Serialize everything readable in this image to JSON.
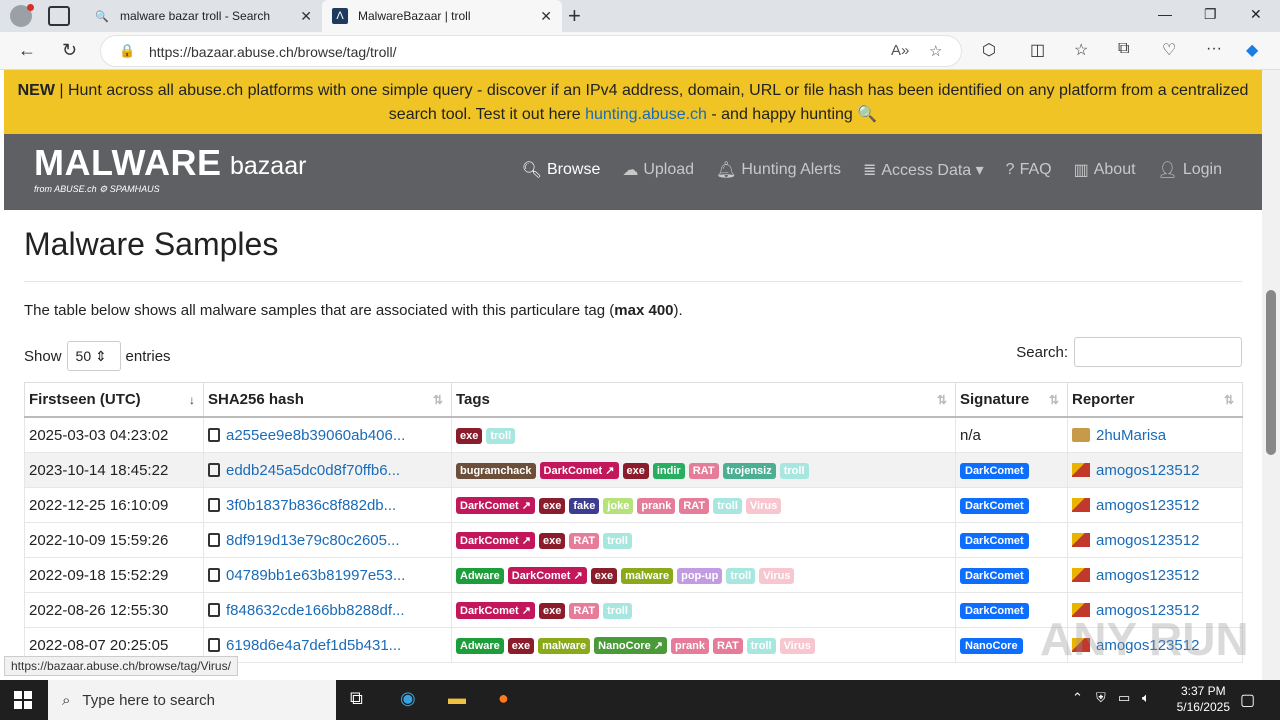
{
  "browser": {
    "tabs": [
      {
        "title": "malware bazar troll - Search"
      },
      {
        "title": "MalwareBazaar | troll"
      }
    ],
    "url": "https://bazaar.abuse.ch/browse/tag/troll/",
    "status_url": "https://bazaar.abuse.ch/browse/tag/Virus/"
  },
  "banner": {
    "new": "NEW",
    "text1": " | Hunt across all abuse.ch platforms with one simple query - discover if an IPv4 address, domain, URL or file hash has been identified on any platform from a centralized search tool. Test it out here ",
    "link": "hunting.abuse.ch",
    "text2": " - and happy hunting 🔍"
  },
  "header": {
    "logo_main": "MALWARE",
    "logo_sub": "bazaar",
    "logo_from": "from ABUSE.ch  ⚙ SPAMHAUS",
    "menu": [
      {
        "icon": "search-icon",
        "label": "Browse",
        "active": true
      },
      {
        "icon": "upload-icon",
        "label": "Upload"
      },
      {
        "icon": "bell-icon",
        "label": "Hunting Alerts"
      },
      {
        "icon": "database-icon",
        "label": "Access Data ▾"
      },
      {
        "icon": "question-icon",
        "label": "FAQ"
      },
      {
        "icon": "building-icon",
        "label": "About"
      },
      {
        "icon": "user-icon",
        "label": "Login"
      }
    ]
  },
  "main": {
    "title": "Malware Samples",
    "desc_pre": "The table below shows all malware samples that are associated with this particulare tag (",
    "desc_bold": "max 400",
    "desc_post": ").",
    "show_label": "Show",
    "show_value": "50 ⇕",
    "entries_label": "entries",
    "search_label": "Search:"
  },
  "table": {
    "columns": [
      "Firstseen (UTC)",
      "SHA256 hash",
      "Tags",
      "Signature",
      "Reporter"
    ],
    "rows": [
      {
        "date": "2025-03-03 04:23:02",
        "hash": "a255ee9e8b39060ab406...",
        "tags": [
          [
            "exe",
            "#8b1c2b"
          ],
          [
            "troll",
            "#a8e6e0"
          ]
        ],
        "sig": "",
        "sig_text": "n/a",
        "reporter": "2huMarisa"
      },
      {
        "date": "2023-10-14 18:45:22",
        "hash": "eddb245a5dc0d8f70ffb6...",
        "tags": [
          [
            "bugramchack",
            "#6b4f3a"
          ],
          [
            "DarkComet ↗",
            "#c2185b"
          ],
          [
            "exe",
            "#8b1c2b"
          ],
          [
            "indir",
            "#27ae60"
          ],
          [
            "RAT",
            "#e57c9a"
          ],
          [
            "trojensiz",
            "#4caf91"
          ],
          [
            "troll",
            "#a8e6e0"
          ]
        ],
        "sig": "DarkComet",
        "reporter": "amogos123512"
      },
      {
        "date": "2022-12-25 16:10:09",
        "hash": "3f0b1837b836c8f882db...",
        "tags": [
          [
            "DarkComet ↗",
            "#c2185b"
          ],
          [
            "exe",
            "#8b1c2b"
          ],
          [
            "fake",
            "#3d3d8f"
          ],
          [
            "joke",
            "#b5e27a"
          ],
          [
            "prank",
            "#e57c9a"
          ],
          [
            "RAT",
            "#e57c9a"
          ],
          [
            "troll",
            "#a8e6e0"
          ],
          [
            "Virus",
            "#f7c6cf"
          ]
        ],
        "sig": "DarkComet",
        "reporter": "amogos123512"
      },
      {
        "date": "2022-10-09 15:59:26",
        "hash": "8df919d13e79c80c2605...",
        "tags": [
          [
            "DarkComet ↗",
            "#c2185b"
          ],
          [
            "exe",
            "#8b1c2b"
          ],
          [
            "RAT",
            "#e57c9a"
          ],
          [
            "troll",
            "#a8e6e0"
          ]
        ],
        "sig": "DarkComet",
        "reporter": "amogos123512"
      },
      {
        "date": "2022-09-18 15:52:29",
        "hash": "04789bb1e63b81997e53...",
        "tags": [
          [
            "Adware",
            "#1e9e3a"
          ],
          [
            "DarkComet ↗",
            "#c2185b"
          ],
          [
            "exe",
            "#8b1c2b"
          ],
          [
            "malware",
            "#8aaa1a"
          ],
          [
            "pop-up",
            "#c39be3"
          ],
          [
            "troll",
            "#a8e6e0"
          ],
          [
            "Virus",
            "#f7c6cf"
          ]
        ],
        "sig": "DarkComet",
        "reporter": "amogos123512"
      },
      {
        "date": "2022-08-26 12:55:30",
        "hash": "f848632cde166bb8288df...",
        "tags": [
          [
            "DarkComet ↗",
            "#c2185b"
          ],
          [
            "exe",
            "#8b1c2b"
          ],
          [
            "RAT",
            "#e57c9a"
          ],
          [
            "troll",
            "#a8e6e0"
          ]
        ],
        "sig": "DarkComet",
        "reporter": "amogos123512"
      },
      {
        "date": "2022-08-07 20:25:05",
        "hash": "6198d6e4a7def1d5b431...",
        "tags": [
          [
            "Adware",
            "#1e9e3a"
          ],
          [
            "exe",
            "#8b1c2b"
          ],
          [
            "malware",
            "#8aaa1a"
          ],
          [
            "NanoCore ↗",
            "#4a9a3a"
          ],
          [
            "prank",
            "#e57c9a"
          ],
          [
            "RAT",
            "#e57c9a"
          ],
          [
            "troll",
            "#a8e6e0"
          ],
          [
            "Virus",
            "#f7c6cf"
          ]
        ],
        "sig": "NanoCore",
        "reporter": "amogos123512"
      }
    ]
  },
  "taskbar": {
    "search_placeholder": "Type here to search",
    "time": "3:37 PM",
    "date": "5/16/2025"
  },
  "watermark": "ANY RUN"
}
